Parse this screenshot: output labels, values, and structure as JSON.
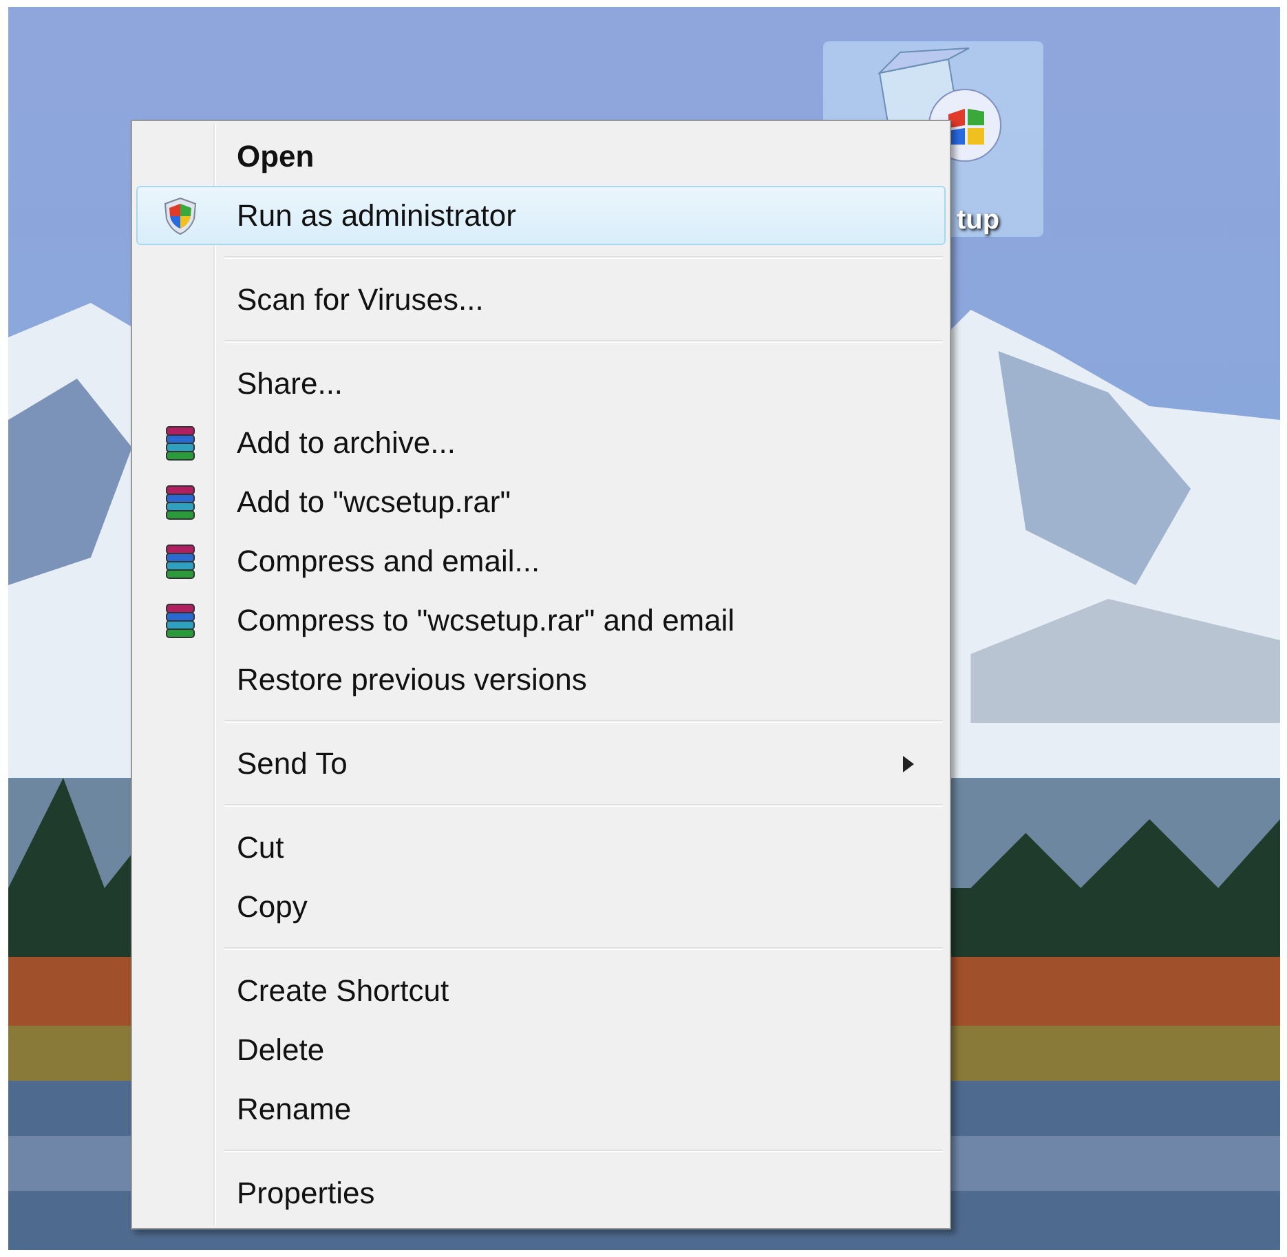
{
  "desktop_icon": {
    "label": "tup",
    "selected": true
  },
  "context_menu": {
    "groups": [
      {
        "items": [
          {
            "label": "Open",
            "kind": "plain",
            "default": true,
            "selected": false,
            "submenu": false
          },
          {
            "label": "Run as administrator",
            "kind": "shield",
            "default": false,
            "selected": true,
            "submenu": false
          }
        ]
      },
      {
        "items": [
          {
            "label": "Scan for Viruses...",
            "kind": "plain",
            "default": false,
            "selected": false,
            "submenu": false
          }
        ]
      },
      {
        "items": [
          {
            "label": "Share...",
            "kind": "plain",
            "default": false,
            "selected": false,
            "submenu": false
          },
          {
            "label": "Add to archive...",
            "kind": "archive",
            "default": false,
            "selected": false,
            "submenu": false
          },
          {
            "label": "Add to \"wcsetup.rar\"",
            "kind": "archive",
            "default": false,
            "selected": false,
            "submenu": false
          },
          {
            "label": "Compress and email...",
            "kind": "archive",
            "default": false,
            "selected": false,
            "submenu": false
          },
          {
            "label": "Compress to \"wcsetup.rar\" and email",
            "kind": "archive",
            "default": false,
            "selected": false,
            "submenu": false
          },
          {
            "label": "Restore previous versions",
            "kind": "plain",
            "default": false,
            "selected": false,
            "submenu": false
          }
        ]
      },
      {
        "items": [
          {
            "label": "Send To",
            "kind": "plain",
            "default": false,
            "selected": false,
            "submenu": true
          }
        ]
      },
      {
        "items": [
          {
            "label": "Cut",
            "kind": "plain",
            "default": false,
            "selected": false,
            "submenu": false
          },
          {
            "label": "Copy",
            "kind": "plain",
            "default": false,
            "selected": false,
            "submenu": false
          }
        ]
      },
      {
        "items": [
          {
            "label": "Create Shortcut",
            "kind": "plain",
            "default": false,
            "selected": false,
            "submenu": false
          },
          {
            "label": "Delete",
            "kind": "plain",
            "default": false,
            "selected": false,
            "submenu": false
          },
          {
            "label": "Rename",
            "kind": "plain",
            "default": false,
            "selected": false,
            "submenu": false
          }
        ]
      },
      {
        "items": [
          {
            "label": "Properties",
            "kind": "plain",
            "default": false,
            "selected": false,
            "submenu": false
          }
        ]
      }
    ]
  }
}
